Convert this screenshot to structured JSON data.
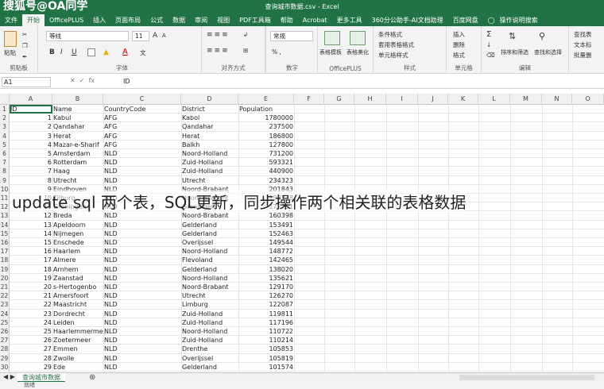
{
  "window": {
    "doc_title": "查询城市数据.csv - Excel"
  },
  "watermark": "搜狐号@OA同学",
  "menu": {
    "tabs": [
      "文件",
      "开始",
      "OfficePLUS",
      "插入",
      "页面布局",
      "公式",
      "数据",
      "审阅",
      "视图",
      "PDF工具箱",
      "帮助",
      "Acrobat",
      "更多工具",
      "360分公助手-AI文档助理",
      "百度网盘"
    ],
    "search": "操作说明搜索"
  },
  "ribbon": {
    "clipboard": {
      "label": "剪贴板",
      "paste": "粘贴"
    },
    "font": {
      "label": "字体",
      "name": "等线",
      "size": "11",
      "bold": "B",
      "italic": "I",
      "underline": "U",
      "grow": "A",
      "shrink": "A",
      "color": "A",
      "wen": "文"
    },
    "align": {
      "label": "对齐方式"
    },
    "officeplus": {
      "label": "OfficePLUS",
      "btn1": "表格模板",
      "btn2": "表格美化"
    },
    "number": {
      "label": "数字",
      "format": "常规"
    },
    "styles": {
      "label": "样式",
      "cond": "条件格式",
      "table": "套用表格格式",
      "cell": "单元格样式"
    },
    "cells": {
      "label": "单元格",
      "insert": "插入",
      "delete": "删除",
      "format": "格式"
    },
    "edit": {
      "label": "编辑",
      "sort": "排序和筛选",
      "find": "查找和选择"
    },
    "right": {
      "r1": "查找表",
      "r2": "文本标",
      "r3": "批量删"
    }
  },
  "formula_bar": {
    "name_box": "A1",
    "fx": "fx",
    "value": "ID"
  },
  "columns": [
    "A",
    "B",
    "C",
    "D",
    "E",
    "F",
    "G",
    "H",
    "I",
    "J",
    "K",
    "L",
    "M",
    "N",
    "O"
  ],
  "rows": [
    {
      "n": "1",
      "id": "ID",
      "name": "Name",
      "code": "CountryCode",
      "district": "District",
      "pop": "Population"
    },
    {
      "n": "2",
      "id": "1",
      "name": "Kabul",
      "code": "AFG",
      "district": "Kabol",
      "pop": "1780000"
    },
    {
      "n": "3",
      "id": "2",
      "name": "Qandahar",
      "code": "AFG",
      "district": "Qandahar",
      "pop": "237500"
    },
    {
      "n": "4",
      "id": "3",
      "name": "Herat",
      "code": "AFG",
      "district": "Herat",
      "pop": "186800"
    },
    {
      "n": "5",
      "id": "4",
      "name": "Mazar-e-Sharif",
      "code": "AFG",
      "district": "Balkh",
      "pop": "127800"
    },
    {
      "n": "6",
      "id": "5",
      "name": "Amsterdam",
      "code": "NLD",
      "district": "Noord-Holland",
      "pop": "731200"
    },
    {
      "n": "7",
      "id": "6",
      "name": "Rotterdam",
      "code": "NLD",
      "district": "Zuid-Holland",
      "pop": "593321"
    },
    {
      "n": "8",
      "id": "7",
      "name": "Haag",
      "code": "NLD",
      "district": "Zuid-Holland",
      "pop": "440900"
    },
    {
      "n": "9",
      "id": "8",
      "name": "Utrecht",
      "code": "NLD",
      "district": "Utrecht",
      "pop": "234323"
    },
    {
      "n": "10",
      "id": "9",
      "name": "Eindhoven",
      "code": "NLD",
      "district": "Noord-Brabant",
      "pop": "201843"
    },
    {
      "n": "11",
      "id": "10",
      "name": "Tilburg",
      "code": "NLD",
      "district": "Noord-Brabant",
      "pop": "193238"
    },
    {
      "n": "12",
      "id": "11",
      "name": "Groningen",
      "code": "NLD",
      "district": "Groningen",
      "pop": "172701"
    },
    {
      "n": "13",
      "id": "12",
      "name": "Breda",
      "code": "NLD",
      "district": "Noord-Brabant",
      "pop": "160398"
    },
    {
      "n": "14",
      "id": "13",
      "name": "Apeldoorn",
      "code": "NLD",
      "district": "Gelderland",
      "pop": "153491"
    },
    {
      "n": "15",
      "id": "14",
      "name": "Nijmegen",
      "code": "NLD",
      "district": "Gelderland",
      "pop": "152463"
    },
    {
      "n": "16",
      "id": "15",
      "name": "Enschede",
      "code": "NLD",
      "district": "Overijssel",
      "pop": "149544"
    },
    {
      "n": "17",
      "id": "16",
      "name": "Haarlem",
      "code": "NLD",
      "district": "Noord-Holland",
      "pop": "148772"
    },
    {
      "n": "18",
      "id": "17",
      "name": "Almere",
      "code": "NLD",
      "district": "Flevoland",
      "pop": "142465"
    },
    {
      "n": "19",
      "id": "18",
      "name": "Arnhem",
      "code": "NLD",
      "district": "Gelderland",
      "pop": "138020"
    },
    {
      "n": "20",
      "id": "19",
      "name": "Zaanstad",
      "code": "NLD",
      "district": "Noord-Holland",
      "pop": "135621"
    },
    {
      "n": "21",
      "id": "20",
      "name": "s-Hertogenbo",
      "code": "NLD",
      "district": "Noord-Brabant",
      "pop": "129170"
    },
    {
      "n": "22",
      "id": "21",
      "name": "Amersfoort",
      "code": "NLD",
      "district": "Utrecht",
      "pop": "126270"
    },
    {
      "n": "23",
      "id": "22",
      "name": "Maastricht",
      "code": "NLD",
      "district": "Limburg",
      "pop": "122087"
    },
    {
      "n": "24",
      "id": "23",
      "name": "Dordrecht",
      "code": "NLD",
      "district": "Zuid-Holland",
      "pop": "119811"
    },
    {
      "n": "25",
      "id": "24",
      "name": "Leiden",
      "code": "NLD",
      "district": "Zuid-Holland",
      "pop": "117196"
    },
    {
      "n": "26",
      "id": "25",
      "name": "Haarlemmermee",
      "code": "NLD",
      "district": "Noord-Holland",
      "pop": "110722"
    },
    {
      "n": "27",
      "id": "26",
      "name": "Zoetermeer",
      "code": "NLD",
      "district": "Zuid-Holland",
      "pop": "110214"
    },
    {
      "n": "28",
      "id": "27",
      "name": "Emmen",
      "code": "NLD",
      "district": "Drenthe",
      "pop": "105853"
    },
    {
      "n": "29",
      "id": "28",
      "name": "Zwolle",
      "code": "NLD",
      "district": "Overijssel",
      "pop": "105819"
    },
    {
      "n": "30",
      "id": "29",
      "name": "Ede",
      "code": "NLD",
      "district": "Gelderland",
      "pop": "101574"
    }
  ],
  "overlay_caption": "update sql 两个表，SQL更新，同步操作两个相关联的表格数据",
  "sheet": {
    "tab": "查询城市数据",
    "add": "⊕",
    "status": "就绪"
  }
}
